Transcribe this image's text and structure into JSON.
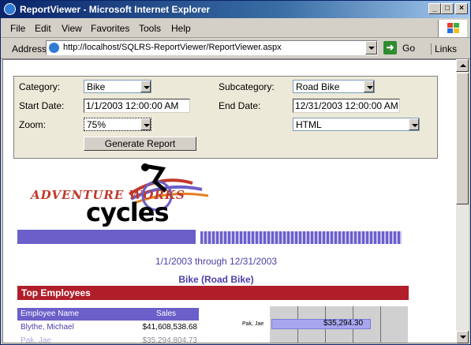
{
  "window": {
    "title": "ReportViewer - Microsoft Internet Explorer",
    "buttons": {
      "minimize": "_",
      "maximize": "□",
      "close": "×"
    }
  },
  "menu": [
    {
      "label": "File"
    },
    {
      "label": "Edit"
    },
    {
      "label": "View"
    },
    {
      "label": "Favorites"
    },
    {
      "label": "Tools"
    },
    {
      "label": "Help"
    }
  ],
  "address_bar": {
    "label": "Address",
    "url": "http://localhost/SQLRS-ReportViewer/ReportViewer.aspx",
    "go_label": "Go",
    "links_label": "Links"
  },
  "params": {
    "category_label": "Category:",
    "category_value": "Bike",
    "subcategory_label": "Subcategory:",
    "subcategory_value": "Road Bike",
    "start_label": "Start Date:",
    "start_value": "1/1/2003 12:00:00 AM",
    "end_label": "End Date:",
    "end_value": "12/31/2003 12:00:00 AM",
    "zoom_label": "Zoom:",
    "zoom_value": "75%",
    "format_value": "HTML",
    "generate_label": "Generate Report"
  },
  "report": {
    "logo_line1": "ADVENTURE WORKS",
    "logo_line2": "cycles",
    "date_range": "1/1/2003 through 12/31/2003",
    "subtitle": "Bike (Road Bike)",
    "section_title": "Top Employees",
    "table_headers": {
      "name": "Employee Name",
      "sales": "Sales"
    },
    "rows": [
      {
        "name": "Blythe, Michael",
        "sales": "$41,608,538.68"
      },
      {
        "name": "Pak, Jae",
        "sales": "$35,294,804.73"
      }
    ],
    "chart": {
      "bar_label": "$35,294.30",
      "bar_fraction": 0.72,
      "y_label": "Pak, Jae"
    }
  },
  "colors": {
    "accent_purple": "#6b5fc9",
    "section_red": "#b01e2a",
    "title_blue": "#0a246a"
  }
}
